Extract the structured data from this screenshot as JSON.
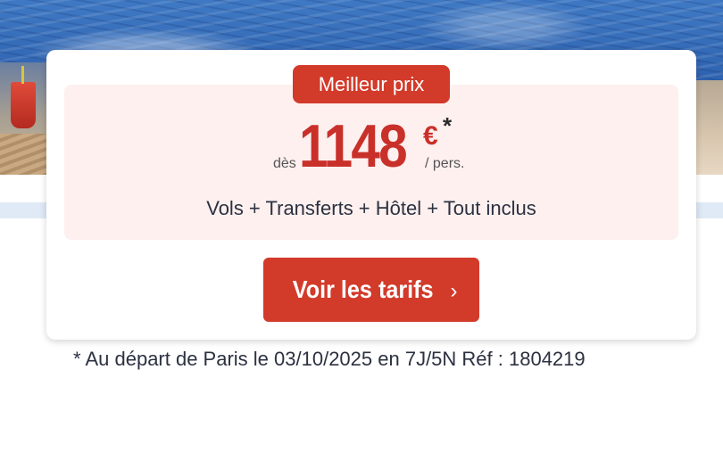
{
  "offer": {
    "badge_label": "Meilleur prix",
    "from_label": "dès",
    "price_amount": "1148",
    "currency": "€",
    "asterisk": "*",
    "per_label": "/ pers.",
    "package": "Vols + Transferts + Hôtel + Tout inclus",
    "cta_label": "Voir les tarifs",
    "cta_icon": "chevron-right-icon"
  },
  "footnote": "* Au départ de Paris le 03/10/2025 en 7J/5N Réf : 1804219",
  "colors": {
    "accent": "#d23a2a",
    "price": "#c9302a",
    "panel": "#fdf0ef",
    "text": "#2c3140"
  }
}
